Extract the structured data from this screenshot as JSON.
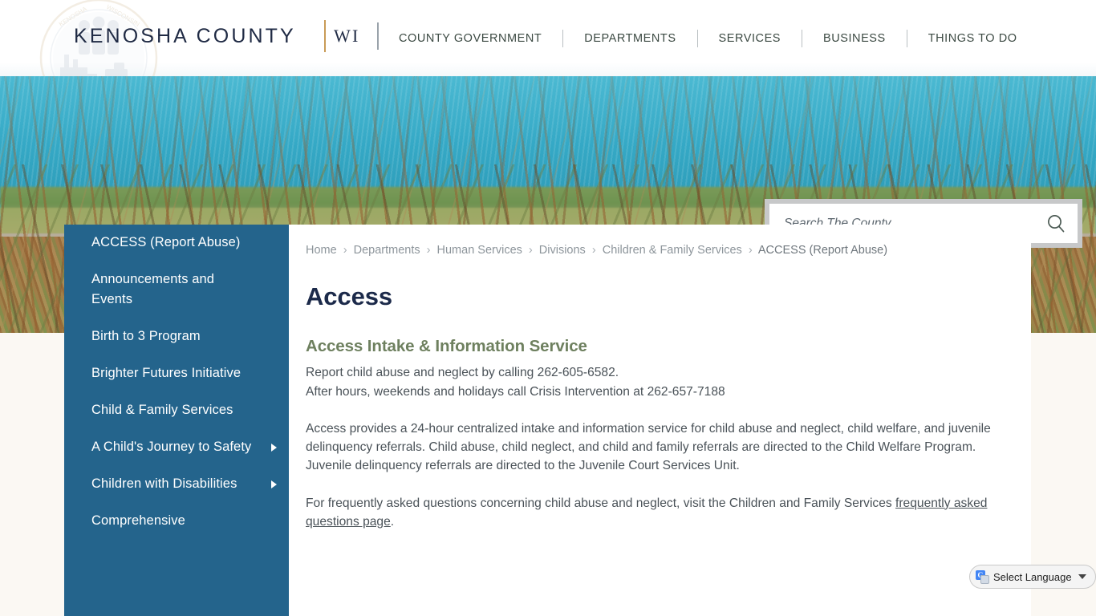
{
  "header": {
    "brand_name": "KENOSHA COUNTY",
    "brand_state": "WI",
    "seal_icon": "county-seal-watermark",
    "nav_items": [
      {
        "label": "COUNTY GOVERNMENT"
      },
      {
        "label": "DEPARTMENTS"
      },
      {
        "label": "SERVICES"
      },
      {
        "label": "BUSINESS"
      },
      {
        "label": "THINGS TO DO"
      }
    ]
  },
  "search": {
    "placeholder": "Search The County...",
    "value": "",
    "icon": "search-icon"
  },
  "sidebar": {
    "items": [
      {
        "label": "ACCESS (Report Abuse)",
        "has_submenu": false
      },
      {
        "label": "Announcements and Events",
        "has_submenu": false
      },
      {
        "label": "Birth to 3 Program",
        "has_submenu": false
      },
      {
        "label": "Brighter Futures Initiative",
        "has_submenu": false
      },
      {
        "label": "Child & Family Services",
        "has_submenu": false
      },
      {
        "label": "A Child's Journey to Safety",
        "has_submenu": true
      },
      {
        "label": "Children with Disabilities",
        "has_submenu": true
      },
      {
        "label": "Comprehensive",
        "has_submenu": false
      }
    ]
  },
  "breadcrumb": {
    "separator": "›",
    "items": [
      {
        "label": "Home",
        "current": false
      },
      {
        "label": "Departments",
        "current": false
      },
      {
        "label": "Human Services",
        "current": false
      },
      {
        "label": "Divisions",
        "current": false
      },
      {
        "label": "Children & Family Services",
        "current": false
      },
      {
        "label": "ACCESS (Report Abuse)",
        "current": true
      }
    ]
  },
  "main": {
    "page_title": "Access",
    "section_heading": "Access Intake & Information Service",
    "line_1": "Report child abuse and neglect by calling 262-605-6582.",
    "line_2": "After hours, weekends and holidays call Crisis Intervention at 262-657-7188",
    "paragraph_1": "Access provides a 24-hour centralized intake and information service for child abuse and neglect, child welfare, and juvenile delinquency referrals. Child abuse, child neglect, and child and family referrals are directed to the Child Welfare Program. Juvenile delinquency referrals are directed to the Juvenile Court Services Unit.",
    "paragraph_2_before": "For frequently asked questions concerning child abuse and neglect, visit the Children and Family Services ",
    "paragraph_2_link": "frequently asked questions page",
    "paragraph_2_after": "."
  },
  "translate": {
    "label": "Select Language",
    "icon": "google-translate-icon",
    "chevron": "chevron-down-icon"
  },
  "colors": {
    "brand_navy": "#1f2a44",
    "sidebar_blue": "#24648c",
    "heading_navy": "#1c2a4a",
    "section_green": "#6e805f",
    "gold_divider": "#c99b57",
    "page_background": "#fbf8f3",
    "body_text": "#4a5258",
    "breadcrumb_text": "#8d959b"
  }
}
